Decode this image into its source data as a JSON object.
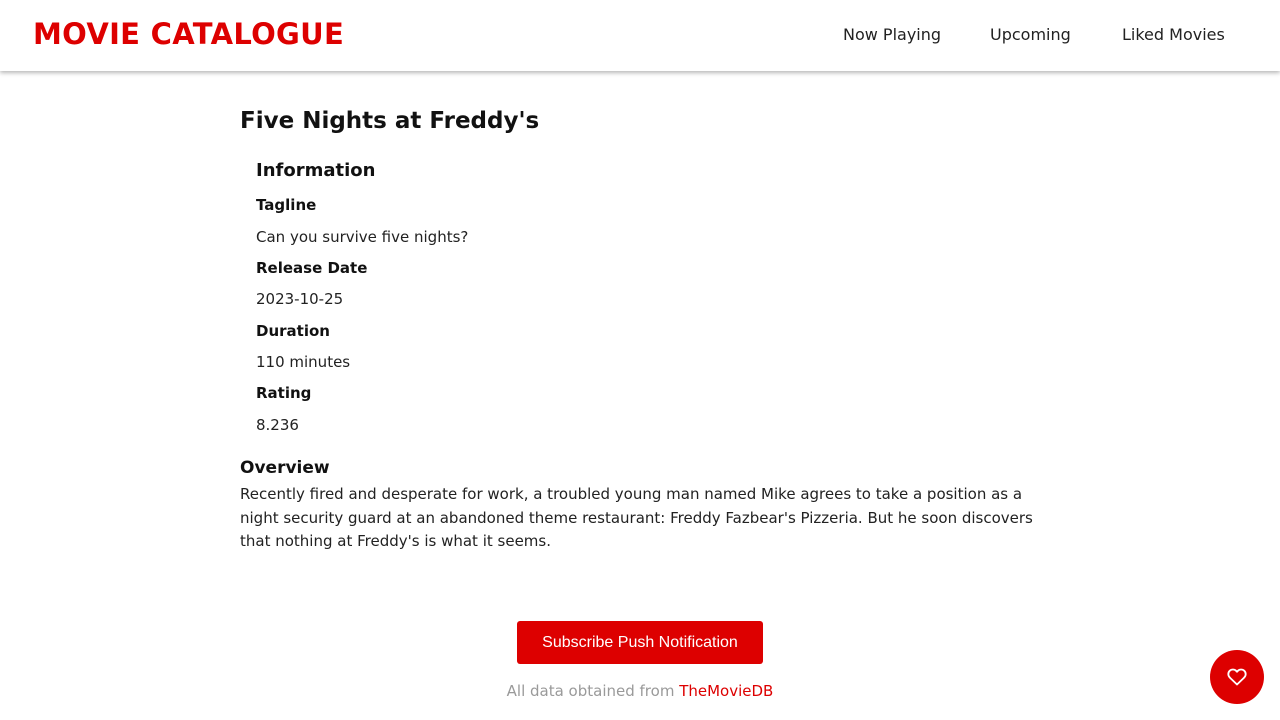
{
  "header": {
    "brand": "MOVIE CATALOGUE",
    "nav": {
      "now_playing": "Now Playing",
      "upcoming": "Upcoming",
      "liked_movies": "Liked Movies"
    }
  },
  "movie": {
    "title": "Five Nights at Freddy's",
    "information_heading": "Information",
    "tagline_label": "Tagline",
    "tagline": "Can you survive five nights?",
    "release_date_label": "Release Date",
    "release_date": "2023-10-25",
    "duration_label": "Duration",
    "duration": "110 minutes",
    "rating_label": "Rating",
    "rating": "8.236",
    "overview_heading": "Overview",
    "overview": "Recently fired and desperate for work, a troubled young man named Mike agrees to take a position as a night security guard at an abandoned theme restaurant: Freddy Fazbear's Pizzeria. But he soon discovers that nothing at Freddy's is what it seems."
  },
  "actions": {
    "subscribe_label": "Subscribe Push Notification",
    "like_button_icon": "heart-icon"
  },
  "footer": {
    "prefix": "All data obtained from",
    "link_text": "TheMovieDB"
  },
  "colors": {
    "accent": "#dd0000",
    "muted_text": "#9a9a9a"
  }
}
